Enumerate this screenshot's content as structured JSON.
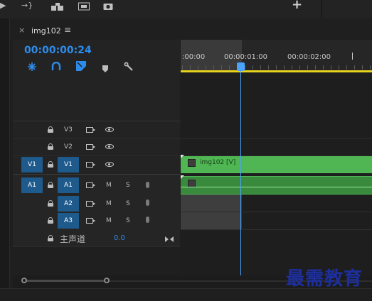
{
  "top_toolbar": {
    "add_label": "+"
  },
  "sequence": {
    "close_label": "×",
    "tab_name": "img102",
    "menu_label": "≡",
    "timecode": "00:00:00:24"
  },
  "ruler": {
    "labels": [
      ":00:00",
      "00:00:01:00",
      "00:00:02:00"
    ]
  },
  "tracks": {
    "video": [
      {
        "id": "V3",
        "source": ""
      },
      {
        "id": "V2",
        "source": ""
      },
      {
        "id": "V1",
        "source": "V1"
      }
    ],
    "audio": [
      {
        "id": "A1",
        "source": "A1",
        "mute": "M",
        "solo": "S"
      },
      {
        "id": "A2",
        "source": "",
        "mute": "M",
        "solo": "S"
      },
      {
        "id": "A3",
        "source": "",
        "mute": "M",
        "solo": "S"
      }
    ],
    "master": {
      "label": "主声道",
      "value": "0.0"
    }
  },
  "clip": {
    "video_label": "img102 [V]"
  },
  "watermark": {
    "text": "最需教育"
  },
  "colors": {
    "accent_blue": "#2d8ceb",
    "clip_green": "#4fb653",
    "playhead": "#4aa3ff",
    "work_area_yellow": "#e6d21e"
  },
  "icons": [
    "ripple-edit-icon",
    "insert-icon",
    "overwrite-icon",
    "export-frame-icon",
    "camera-icon",
    "snap-icon",
    "linked-selection-icon",
    "add-marker-icon",
    "wrench-icon",
    "lock-icon",
    "camera-toggle-icon",
    "eye-icon",
    "microphone-icon"
  ]
}
